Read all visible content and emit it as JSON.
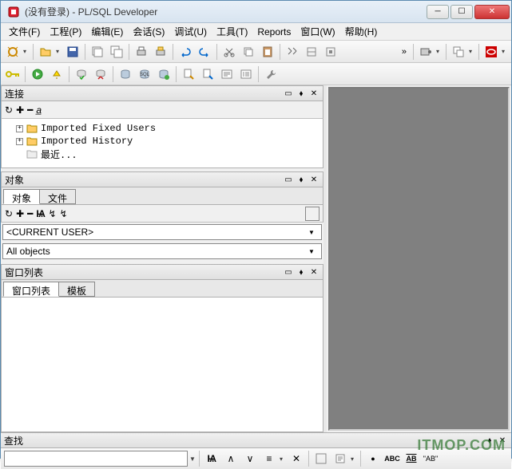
{
  "title": "(没有登录) - PL/SQL Developer",
  "menu": {
    "file": "文件(F)",
    "project": "工程(P)",
    "edit": "编辑(E)",
    "session": "会话(S)",
    "debug": "调试(U)",
    "tool": "工具(T)",
    "reports": "Reports",
    "window": "窗口(W)",
    "help": "帮助(H)"
  },
  "panels": {
    "conn": {
      "title": "连接",
      "tree": [
        "Imported Fixed Users",
        "Imported History",
        "最近..."
      ]
    },
    "obj": {
      "title": "对象",
      "tabs": [
        "对象",
        "文件"
      ],
      "combos": {
        "user": "<CURRENT USER>",
        "filter": "All objects"
      }
    },
    "winlist": {
      "title": "窗口列表",
      "tabs": [
        "窗口列表",
        "模板"
      ]
    },
    "find": {
      "title": "查找"
    }
  },
  "toolbar_chevron": "»",
  "watermark": "ITMOP.COM"
}
